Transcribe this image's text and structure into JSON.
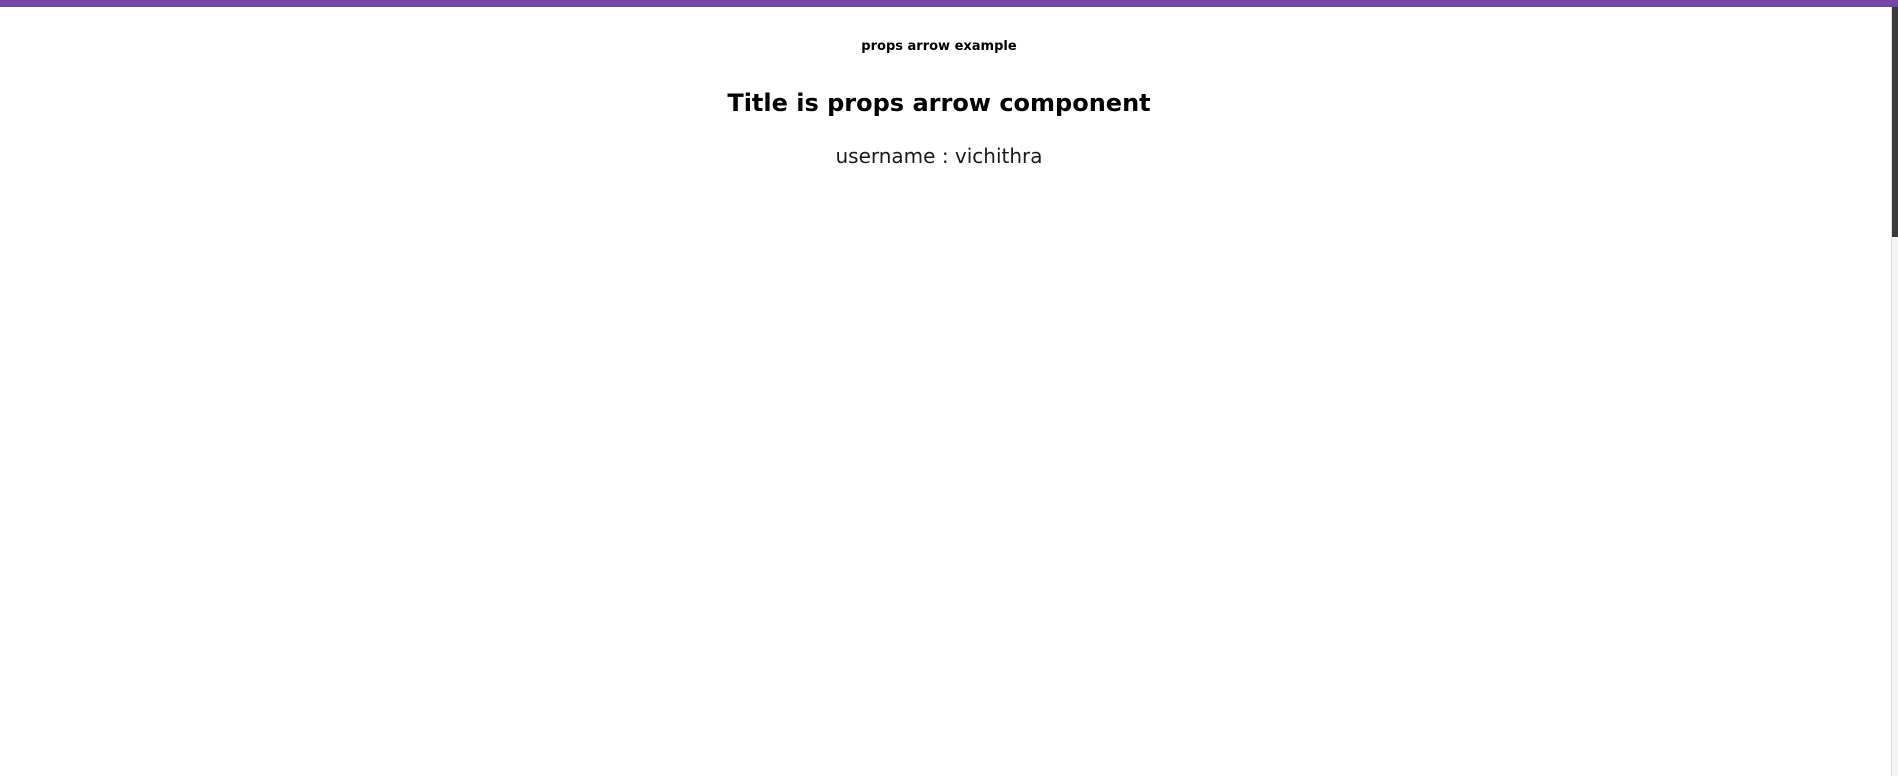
{
  "colors": {
    "accent_bar": "#7445a6",
    "background": "#ffffff",
    "text": "#000000",
    "scroll_thumb": "#3a3a3a"
  },
  "page": {
    "small_heading": "props arrow example",
    "title": "Title is props arrow component",
    "username_line": "username : vichithra"
  }
}
